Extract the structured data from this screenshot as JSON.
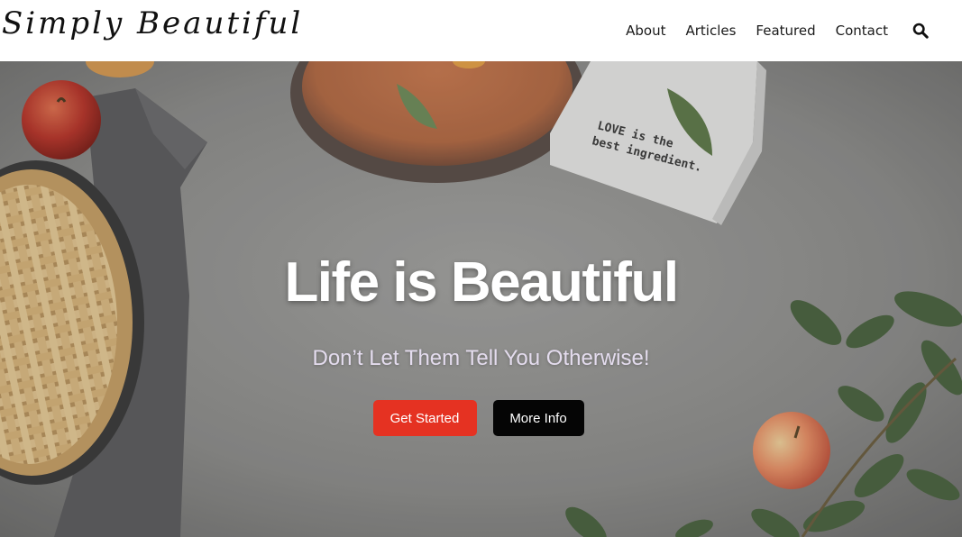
{
  "header": {
    "logo": "Simply Beautiful",
    "nav": [
      "About",
      "Articles",
      "Featured",
      "Contact"
    ],
    "search_icon": "search-icon"
  },
  "hero": {
    "title": "Life is Beautiful",
    "subtitle": "Don’t Let Them Tell You Otherwise!",
    "primary_button": "Get Started",
    "secondary_button": "More Info",
    "towel_text_line1": "LOVE is the",
    "towel_text_line2": "best ingredient.",
    "background_image": "kitchen-countertop-with-pie-apples-plate-and-leaves"
  },
  "colors": {
    "primary_button": "#e53222",
    "secondary_button": "#050505",
    "subtitle": "#e4dcee",
    "countertop": "#8f8f8d"
  }
}
